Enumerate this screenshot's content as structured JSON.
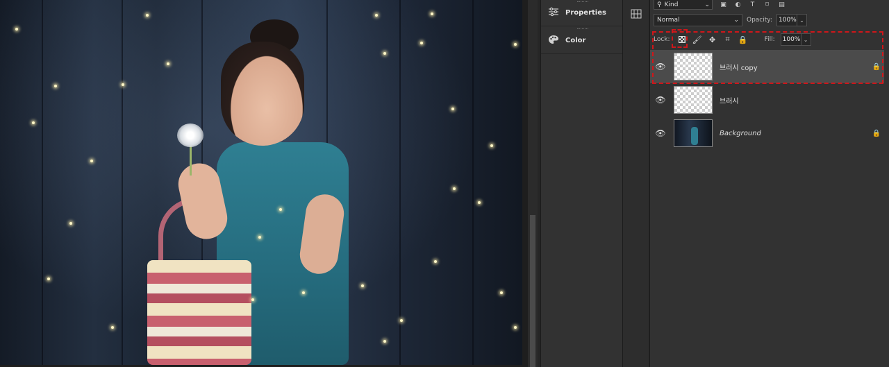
{
  "panels": {
    "properties_label": "Properties",
    "color_label": "Color"
  },
  "layers_panel": {
    "filter_kind": "Kind",
    "blend_mode": "Normal",
    "opacity_label": "Opacity:",
    "opacity_value": "100%",
    "lock_label": "Lock:",
    "fill_label": "Fill:",
    "fill_value": "100%",
    "layers": [
      {
        "name": "브러시 copy",
        "visible": true,
        "selected": true,
        "locked": true
      },
      {
        "name": "브러시",
        "visible": true,
        "selected": false,
        "locked": false
      },
      {
        "name": "Background",
        "visible": true,
        "selected": false,
        "locked": true
      }
    ]
  },
  "icons": {
    "properties": "sliders-icon",
    "color": "palette-icon",
    "lock_transparent": "checkerboard-icon",
    "lock_brush": "brush-icon",
    "lock_move": "move-icon",
    "lock_artboard": "crop-icon",
    "lock_all": "lock-icon",
    "visibility": "eye-icon"
  },
  "colors": {
    "highlight": "#d0161a",
    "panel_bg": "#323232",
    "selected_row": "#4b4b4b"
  }
}
